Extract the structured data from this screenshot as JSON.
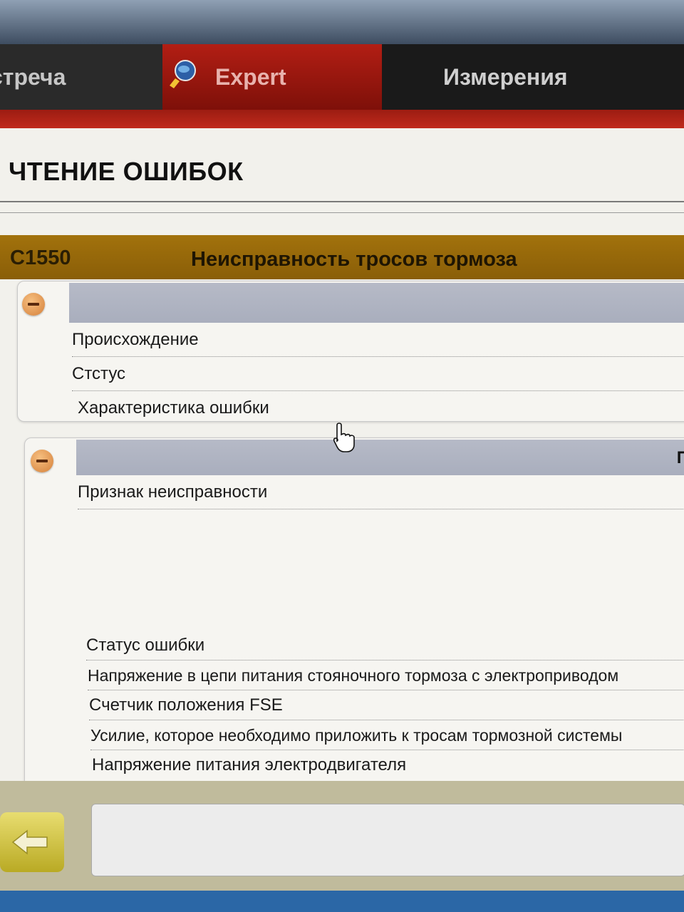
{
  "tabs": [
    {
      "label": "стреча"
    },
    {
      "label": "Expert",
      "active": true
    },
    {
      "label": "Измерения"
    }
  ],
  "page": {
    "title": "ЧТЕНИЕ ОШИБОК"
  },
  "fault": {
    "code": "C1550",
    "description": "Неисправность тросов тормоза"
  },
  "panel1": {
    "rows": [
      {
        "label": "Происхождение"
      },
      {
        "label": "Стстус"
      },
      {
        "label": "Характеристика ошибки"
      }
    ]
  },
  "panel2": {
    "header_text": "Пер",
    "rows": [
      {
        "label": "Признак неисправности"
      },
      {
        "label": "Статус ошибки"
      },
      {
        "label": "Напряжение в цепи питания стояночного тормоза с электроприводом"
      },
      {
        "label": "Счетчик положения FSE"
      },
      {
        "label": "Усилие, которое необходимо приложить к тросам тормозной системы"
      },
      {
        "label": "Напряжение питания электродвигателя"
      }
    ]
  },
  "icons": {
    "expert_logo": "expert-magnifier-icon",
    "collapse": "collapse-minus-icon",
    "back": "back-arrow-icon",
    "cursor": "hand-pointer-icon"
  },
  "colors": {
    "accent_red": "#b21e14",
    "fault_bar": "#a2720c",
    "panel_header": "#b6bac7",
    "collapse_button": "#e8a25c"
  }
}
